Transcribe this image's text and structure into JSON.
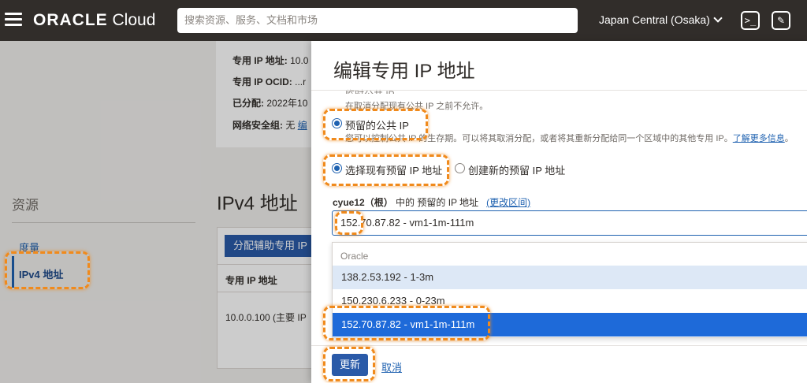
{
  "topbar": {
    "brand_bold": "ORACLE",
    "brand_rest": " Cloud",
    "search_placeholder": "搜索资源、服务、文档和市场",
    "region": "Japan Central (Osaka)",
    "icons": [
      "menu-icon",
      "cloud-shell-icon",
      "edit-icon"
    ]
  },
  "background_page": {
    "details": [
      {
        "label": "专用 IP 地址: ",
        "value": "10.0"
      },
      {
        "label": "专用 IP OCID: ",
        "value": "...r"
      },
      {
        "label": "已分配: ",
        "value": "2022年10"
      },
      {
        "label": "网络安全组: ",
        "value": "无 ",
        "link": "编"
      }
    ],
    "resources_title": "资源",
    "resources_items": [
      "度量",
      "IPv4 地址"
    ],
    "section_title": "IPv4 地址",
    "assign_button": "分配辅助专用 IP",
    "table_header": "专用 IP 地址",
    "table_row": "10.0.0.100 (主要 IP"
  },
  "panel": {
    "title": "编辑专用 IP 地址",
    "cut_option": "临时公共 IP",
    "cut_option_help": "在取消分配现有公共 IP 之前不允许。",
    "reserved_option": "预留的公共 IP",
    "reserved_help": "您可以控制公共 IP 的生存期。可以将其取消分配，或者将其重新分配给同一个区域中的其他专用 IP。",
    "learn_more": "了解更多信息",
    "learn_more_suffix": "。",
    "choose_existing": "选择现有预留 IP 地址",
    "create_new": "创建新的预留 IP 地址",
    "field_label_compartment": "cyue12（根）",
    "field_label_rest": " 中的 预留的 IP 地址",
    "change_compartment": "(更改区间)",
    "selected_value": "152.70.87.82 - vm1-1m-111m",
    "dropdown_group": "Oracle",
    "dropdown_options": [
      "138.2.53.192 - 1-3m",
      "150.230.6.233 - 0-23m",
      "152.70.87.82 - vm1-1m-111m"
    ],
    "update_button": "更新",
    "cancel_link": "取消"
  },
  "colors": {
    "topbar": "#312d2a",
    "primary": "#2a5aa8",
    "link": "#1e61b0",
    "highlight_annotation": "#f08a1c",
    "selected_option": "#1e6ad9"
  }
}
